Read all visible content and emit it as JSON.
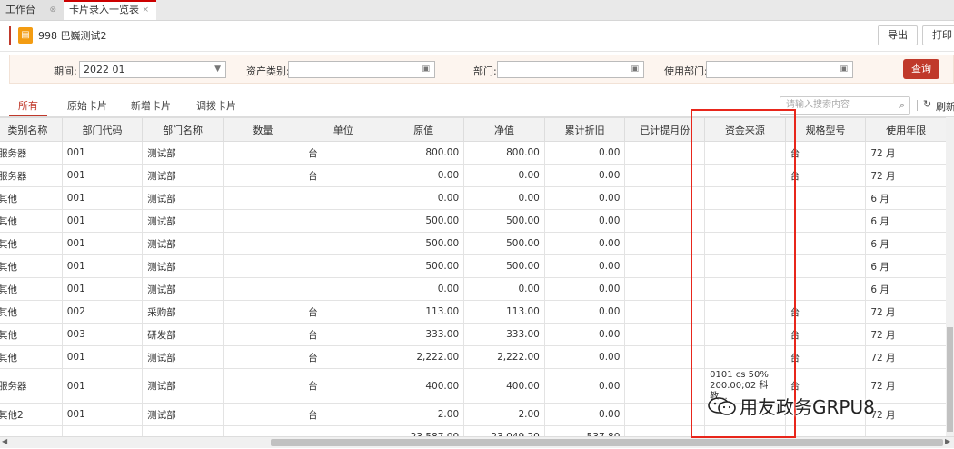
{
  "tabs": [
    {
      "label": "工作台",
      "close": "⊗"
    },
    {
      "label": "卡片录入一览表",
      "close": "×"
    }
  ],
  "header": {
    "title": "998 巴巍测试2",
    "export_label": "导出",
    "print_label": "打印"
  },
  "filter": {
    "period_label": "期间:",
    "period_value": "2022 01",
    "asset_type_label": "资产类别:",
    "dept_label": "部门:",
    "use_dept_label": "使用部门:",
    "query_label": "查询"
  },
  "subtabs": [
    "所有",
    "原始卡片",
    "新增卡片",
    "调拨卡片"
  ],
  "search": {
    "placeholder": "请输入搜索内容"
  },
  "refresh_label": "刷新",
  "table": {
    "columns": [
      "类别名称",
      "部门代码",
      "部门名称",
      "数量",
      "单位",
      "原值",
      "净值",
      "累计折旧",
      "已计提月份",
      "资金来源",
      "规格型号",
      "使用年限"
    ],
    "rows": [
      [
        "服务器",
        "001",
        "测试部",
        "",
        "台",
        "800.00",
        "800.00",
        "0.00",
        "",
        "",
        "台",
        "72 月"
      ],
      [
        "服务器",
        "001",
        "测试部",
        "",
        "台",
        "0.00",
        "0.00",
        "0.00",
        "",
        "",
        "台",
        "72 月"
      ],
      [
        "其他",
        "001",
        "测试部",
        "",
        "",
        "0.00",
        "0.00",
        "0.00",
        "",
        "",
        "",
        "6 月"
      ],
      [
        "其他",
        "001",
        "测试部",
        "",
        "",
        "500.00",
        "500.00",
        "0.00",
        "",
        "",
        "",
        "6 月"
      ],
      [
        "其他",
        "001",
        "测试部",
        "",
        "",
        "500.00",
        "500.00",
        "0.00",
        "",
        "",
        "",
        "6 月"
      ],
      [
        "其他",
        "001",
        "测试部",
        "",
        "",
        "500.00",
        "500.00",
        "0.00",
        "",
        "",
        "",
        "6 月"
      ],
      [
        "其他",
        "001",
        "测试部",
        "",
        "",
        "0.00",
        "0.00",
        "0.00",
        "",
        "",
        "",
        "6 月"
      ],
      [
        "其他",
        "002",
        "采购部",
        "",
        "台",
        "113.00",
        "113.00",
        "0.00",
        "",
        "",
        "台",
        "72 月"
      ],
      [
        "其他",
        "003",
        "研发部",
        "",
        "台",
        "333.00",
        "333.00",
        "0.00",
        "",
        "",
        "台",
        "72 月"
      ],
      [
        "其他",
        "001",
        "测试部",
        "",
        "台",
        "2,222.00",
        "2,222.00",
        "0.00",
        "",
        "",
        "台",
        "72 月"
      ],
      [
        "服务器",
        "001",
        "测试部",
        "",
        "台",
        "400.00",
        "400.00",
        "0.00",
        "",
        "0101 cs 50% 200.00;02 科教...",
        "台",
        "72 月"
      ],
      [
        "其他2",
        "001",
        "测试部",
        "",
        "台",
        "2.00",
        "2.00",
        "0.00",
        "",
        "",
        "",
        "72 月"
      ]
    ],
    "totals": [
      "",
      "",
      "",
      "",
      "",
      "23,587.00",
      "23,049.20",
      "537.80",
      "",
      "",
      "",
      ""
    ]
  },
  "watermark": {
    "text": "用友政务GRPU8",
    "icon": "wechat-icon"
  },
  "colors": {
    "accent": "#c0392b",
    "highlight_box": "#e8261b"
  }
}
